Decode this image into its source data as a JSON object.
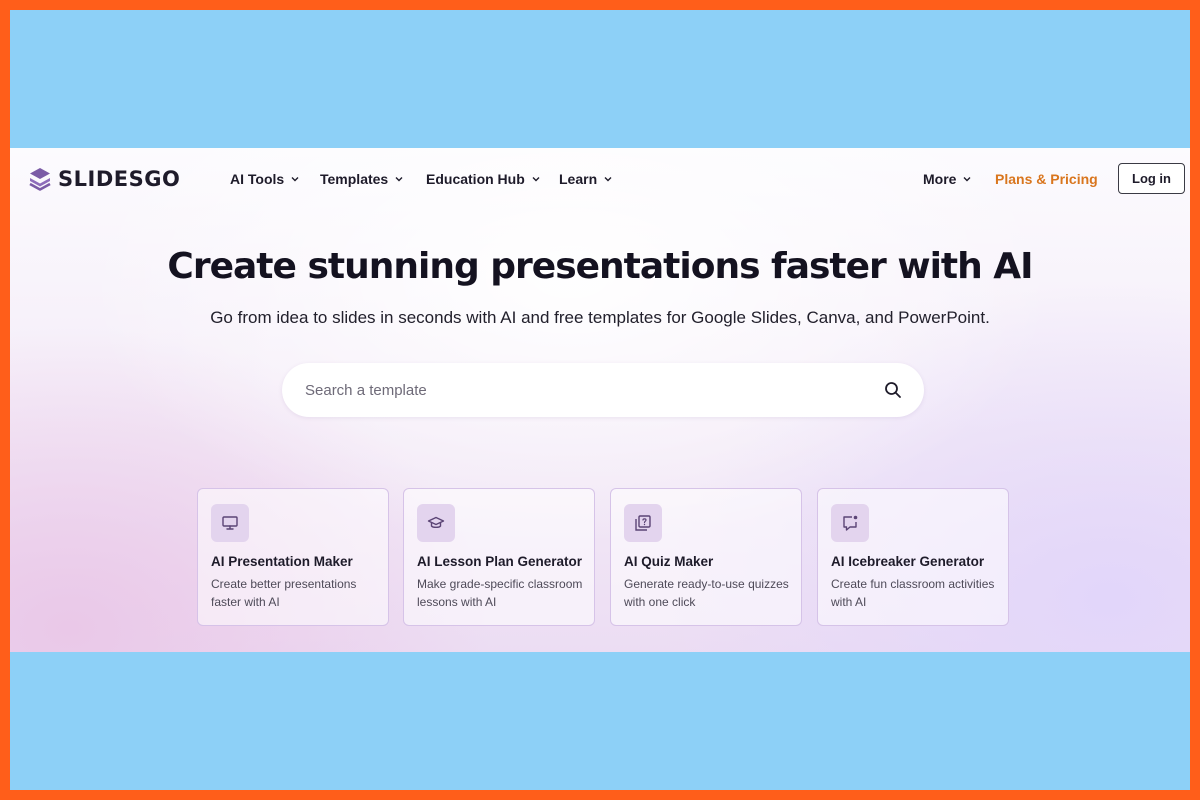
{
  "nav": {
    "logo_text": "SLIDESGO",
    "menu": [
      {
        "label": "AI Tools"
      },
      {
        "label": "Templates"
      },
      {
        "label": "Education Hub"
      },
      {
        "label": "Learn"
      }
    ],
    "more_label": "More",
    "pricing_label": "Plans & Pricing",
    "login_label": "Log in"
  },
  "hero": {
    "title": "Create stunning presentations faster with AI",
    "subtitle": "Go from idea to slides in seconds with AI and free templates for Google Slides, Canva, and PowerPoint."
  },
  "search": {
    "placeholder": "Search a template",
    "value": ""
  },
  "cards": [
    {
      "title": "AI Presentation Maker",
      "desc": "Create better presentations faster with AI",
      "icon": "monitor-icon"
    },
    {
      "title": "AI Lesson Plan Generator",
      "desc": "Make grade-specific classroom lessons with AI",
      "icon": "graduation-cap-icon"
    },
    {
      "title": "AI Quiz Maker",
      "desc": "Generate ready-to-use quizzes with one click",
      "icon": "quiz-icon"
    },
    {
      "title": "AI Icebreaker Generator",
      "desc": "Create fun classroom activities with AI",
      "icon": "chat-bubble-icon"
    }
  ],
  "colors": {
    "frame_border": "#FF5E1A",
    "frame_fill": "#8DD0F7",
    "brand_purple": "#7B5BA6",
    "pricing_accent": "#D9761E",
    "text_dark": "#1E1B2A"
  }
}
